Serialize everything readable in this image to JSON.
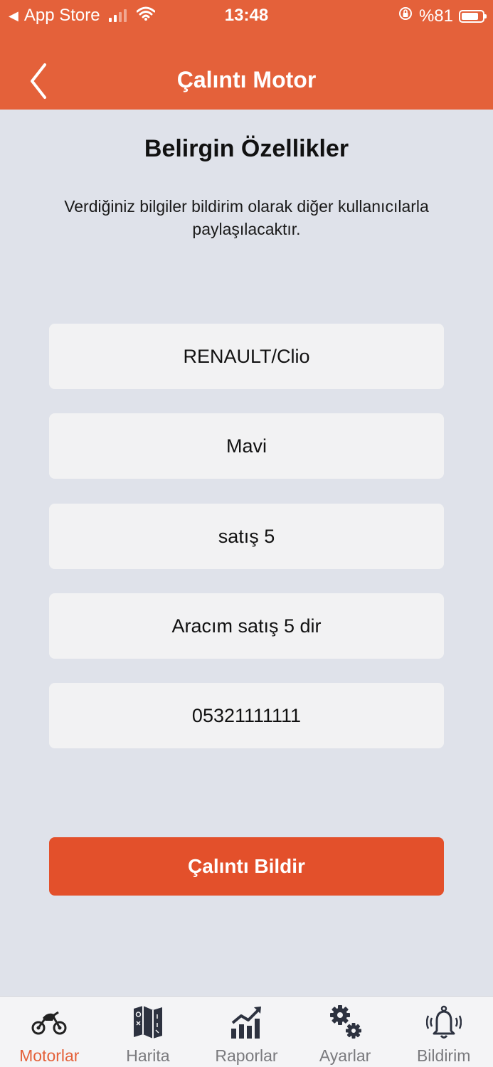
{
  "status_bar": {
    "back_app": "App Store",
    "time": "13:48",
    "battery": "%81",
    "battery_level": 0.81
  },
  "nav": {
    "title": "Çalıntı Motor"
  },
  "main": {
    "section_title": "Belirgin Özellikler",
    "description": "Verdiğiniz bilgiler bildirim olarak diğer kullanıcılarla paylaşılacaktır.",
    "fields": [
      {
        "value": "RENAULT/Clio"
      },
      {
        "value": "Mavi"
      },
      {
        "value": "satış 5"
      },
      {
        "value": "Aracım satış 5 dir"
      },
      {
        "value": "05321111111"
      }
    ],
    "submit_label": "Çalıntı Bildir"
  },
  "tabbar": {
    "items": [
      {
        "label": "Motorlar",
        "icon": "motorcycle-icon",
        "active": true
      },
      {
        "label": "Harita",
        "icon": "map-icon",
        "active": false
      },
      {
        "label": "Raporlar",
        "icon": "chart-icon",
        "active": false
      },
      {
        "label": "Ayarlar",
        "icon": "gears-icon",
        "active": false
      },
      {
        "label": "Bildirim",
        "icon": "bell-icon",
        "active": false
      }
    ]
  },
  "colors": {
    "accent": "#e4613a",
    "button": "#e3502b",
    "background": "#dfe2ea"
  }
}
